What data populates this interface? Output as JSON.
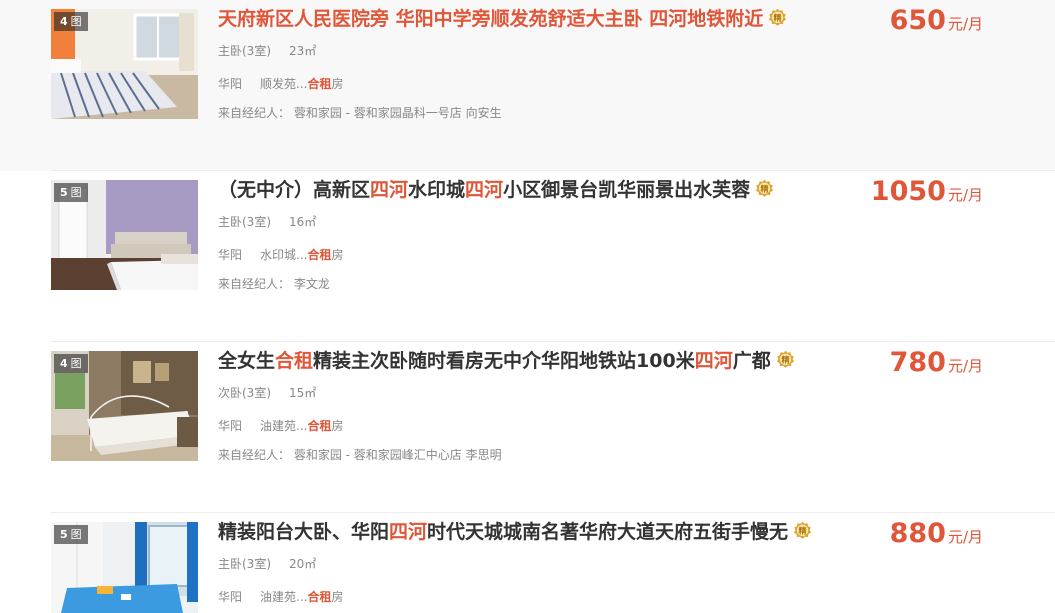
{
  "listings": [
    {
      "photo_count": "4",
      "photo_unit": "图",
      "title_parts": [
        {
          "text": "天府新区人民医院旁 华阳中学旁顺发苑舒适大主卧 四河地铁附近",
          "kw": false
        }
      ],
      "medal": "精",
      "room_type": "主卧(3室)",
      "area": "23㎡",
      "city": "华阳",
      "community": "顺发苑...",
      "rent_type_kw": "合租",
      "rent_type_suffix": "房",
      "agent": "来自经纪人：  蓉和家园 - 蓉和家园晶科一号店 向安生",
      "price": "650",
      "price_unit": "元/月"
    },
    {
      "photo_count": "5",
      "photo_unit": "图",
      "title_parts": [
        {
          "text": "（无中介）高新区",
          "kw": false
        },
        {
          "text": "四河",
          "kw": true
        },
        {
          "text": "水印城",
          "kw": false
        },
        {
          "text": "四河",
          "kw": true
        },
        {
          "text": "小区御景台凯华丽景出水芙蓉",
          "kw": false
        }
      ],
      "medal": "精",
      "room_type": "主卧(3室)",
      "area": "16㎡",
      "city": "华阳",
      "community": "水印城...",
      "rent_type_kw": "合租",
      "rent_type_suffix": "房",
      "agent": "来自经纪人：  李文龙",
      "price": "1050",
      "price_unit": "元/月"
    },
    {
      "photo_count": "4",
      "photo_unit": "图",
      "title_parts": [
        {
          "text": "全女生",
          "kw": false
        },
        {
          "text": "合租",
          "kw": true
        },
        {
          "text": "精装主次卧随时看房无中介华阳地铁站100米",
          "kw": false
        },
        {
          "text": "四河",
          "kw": true
        },
        {
          "text": "广都",
          "kw": false
        }
      ],
      "medal": "精",
      "room_type": "次卧(3室)",
      "area": "15㎡",
      "city": "华阳",
      "community": "油建苑...",
      "rent_type_kw": "合租",
      "rent_type_suffix": "房",
      "agent": "来自经纪人：  蓉和家园 - 蓉和家园峰汇中心店 李思明",
      "price": "780",
      "price_unit": "元/月"
    },
    {
      "photo_count": "5",
      "photo_unit": "图",
      "title_parts": [
        {
          "text": "精装阳台大卧、华阳",
          "kw": false
        },
        {
          "text": "四河",
          "kw": true
        },
        {
          "text": "时代天城城南名著华府大道天府五街手慢无",
          "kw": false
        }
      ],
      "medal": "精",
      "room_type": "主卧(3室)",
      "area": "20㎡",
      "city": "华阳",
      "community": "油建苑...",
      "rent_type_kw": "合租",
      "rent_type_suffix": "房",
      "agent": "",
      "price": "880",
      "price_unit": "元/月"
    }
  ]
}
